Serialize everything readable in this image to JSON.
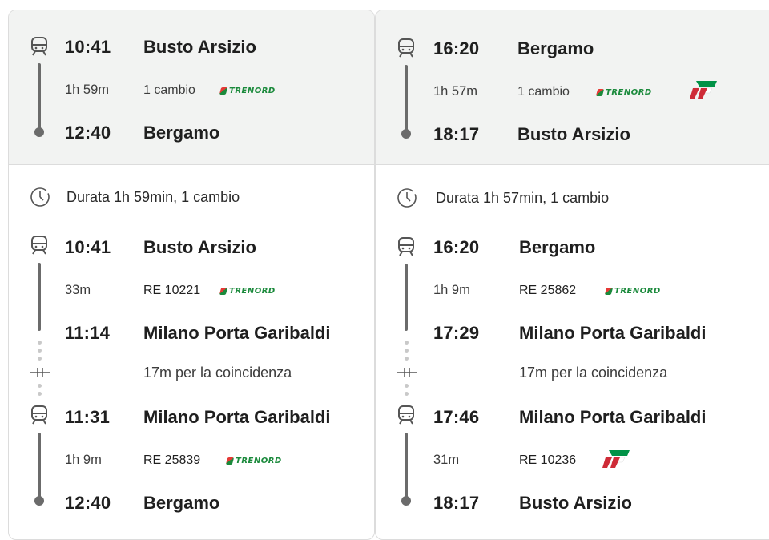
{
  "left": {
    "summary": {
      "dep_time": "10:41",
      "dep_station": "Busto Arsizio",
      "duration": "1h 59m",
      "changes": "1 cambio",
      "arr_time": "12:40",
      "arr_station": "Bergamo",
      "operators": [
        "trenord"
      ]
    },
    "detail": {
      "duration_text": "Durata 1h 59min, 1 cambio",
      "leg1": {
        "dep_time": "10:41",
        "dep_station": "Busto Arsizio",
        "duration": "33m",
        "train": "RE 10221",
        "operator": "trenord",
        "arr_time": "11:14",
        "arr_station": "Milano Porta Garibaldi"
      },
      "transfer": "17m per la coincidenza",
      "leg2": {
        "dep_time": "11:31",
        "dep_station": "Milano Porta Garibaldi",
        "duration": "1h 9m",
        "train": "RE 25839",
        "operator": "trenord",
        "arr_time": "12:40",
        "arr_station": "Bergamo"
      }
    }
  },
  "right": {
    "summary": {
      "dep_time": "16:20",
      "dep_station": "Bergamo",
      "duration": "1h 57m",
      "changes": "1 cambio",
      "arr_time": "18:17",
      "arr_station": "Busto Arsizio",
      "operators": [
        "trenord",
        "trenitalia"
      ]
    },
    "detail": {
      "duration_text": "Durata 1h 57min, 1 cambio",
      "leg1": {
        "dep_time": "16:20",
        "dep_station": "Bergamo",
        "duration": "1h 9m",
        "train": "RE 25862",
        "operator": "trenord",
        "arr_time": "17:29",
        "arr_station": "Milano Porta Garibaldi"
      },
      "transfer": "17m per la coincidenza",
      "leg2": {
        "dep_time": "17:46",
        "dep_station": "Milano Porta Garibaldi",
        "duration": "31m",
        "train": "RE 10236",
        "operator": "trenitalia",
        "arr_time": "18:17",
        "arr_station": "Busto Arsizio"
      }
    }
  },
  "brand": {
    "trenord_text": "TRENORD",
    "trenord_green": "#1b8a3c",
    "trenord_red": "#e53935",
    "trenitalia_green": "#009246",
    "trenitalia_red": "#ce2b37"
  }
}
